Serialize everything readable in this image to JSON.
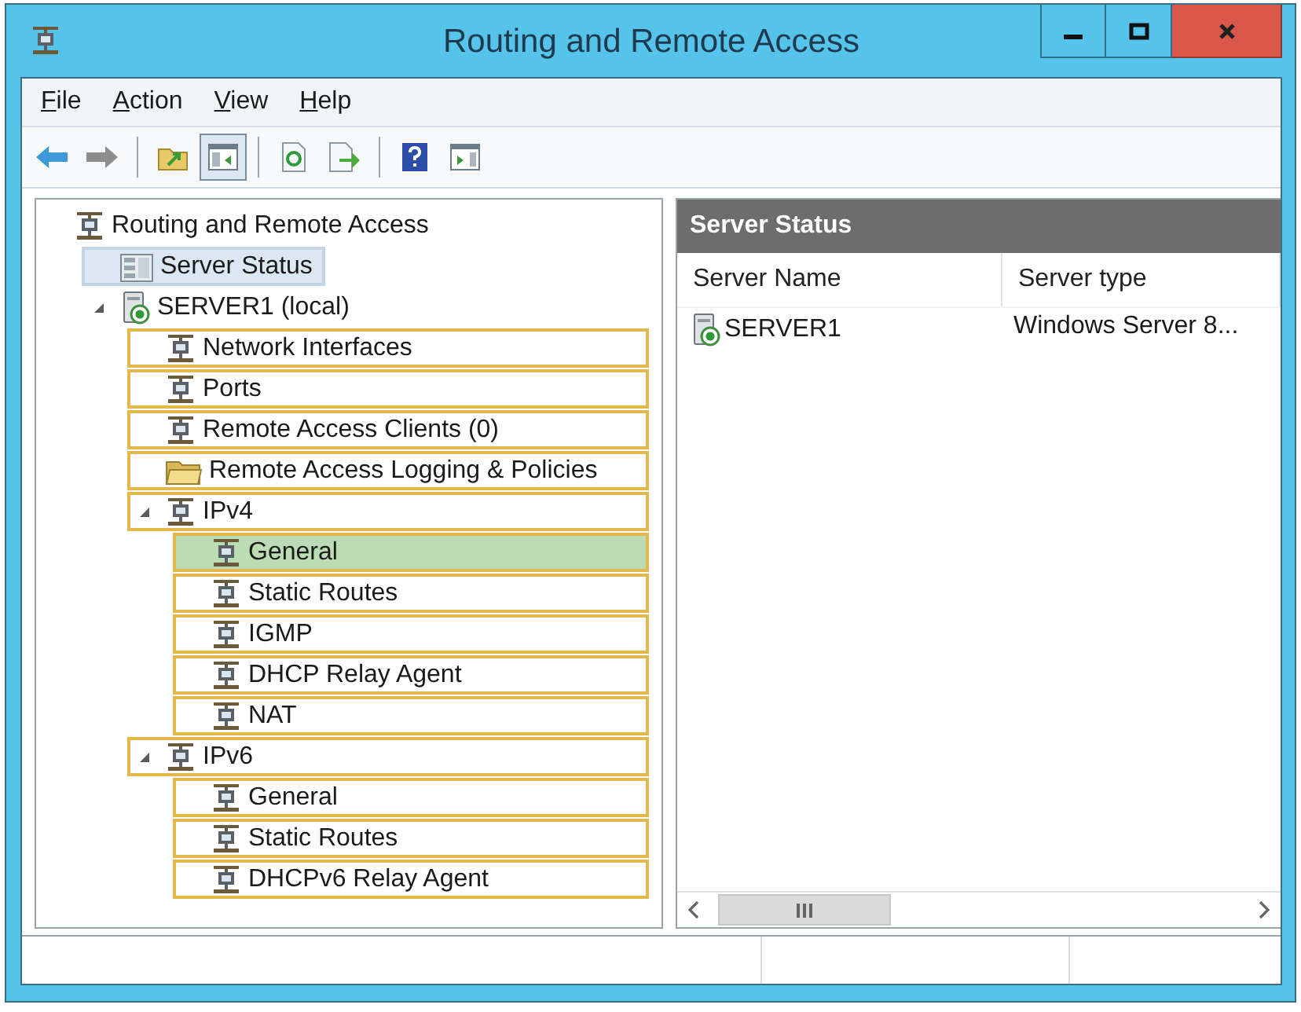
{
  "window": {
    "title": "Routing and Remote Access"
  },
  "menu": [
    {
      "label": "File",
      "access_key_underlined": true
    },
    {
      "label": "Action",
      "access_key_underlined": true
    },
    {
      "label": "View",
      "access_key_underlined": true
    },
    {
      "label": "Help",
      "access_key_underlined": true
    }
  ],
  "toolbar": [
    {
      "kind": "back",
      "pressed": false
    },
    {
      "kind": "forward",
      "pressed": false
    },
    {
      "kind": "separator"
    },
    {
      "kind": "up",
      "pressed": false
    },
    {
      "kind": "tree",
      "pressed": true
    },
    {
      "kind": "separator"
    },
    {
      "kind": "refresh",
      "pressed": false
    },
    {
      "kind": "export",
      "pressed": false
    },
    {
      "kind": "separator"
    },
    {
      "kind": "help",
      "pressed": false
    },
    {
      "kind": "pane",
      "pressed": false
    }
  ],
  "tree": {
    "label": "Routing and Remote Access",
    "kind": "network",
    "selected": false,
    "outlined": false,
    "marked": false,
    "children": [
      {
        "label": "Server Status",
        "kind": "serverlist",
        "selected": true,
        "outlined": false,
        "marked": false
      },
      {
        "label": "SERVER1 (local)",
        "kind": "server",
        "selected": false,
        "outlined": false,
        "marked": false,
        "expanded": true,
        "children": [
          {
            "label": "Network Interfaces",
            "kind": "network",
            "selected": false,
            "outlined": true,
            "marked": false
          },
          {
            "label": "Ports",
            "kind": "network",
            "selected": false,
            "outlined": true,
            "marked": false
          },
          {
            "label": "Remote Access Clients (0)",
            "kind": "network",
            "selected": false,
            "outlined": true,
            "marked": false
          },
          {
            "label": "Remote Access Logging & Policies",
            "kind": "folder",
            "selected": false,
            "outlined": true,
            "marked": false
          },
          {
            "label": "IPv4",
            "kind": "network",
            "selected": false,
            "outlined": true,
            "marked": false,
            "expanded": true,
            "children": [
              {
                "label": "General",
                "kind": "network",
                "selected": false,
                "outlined": true,
                "marked": true
              },
              {
                "label": "Static Routes",
                "kind": "network",
                "selected": false,
                "outlined": true,
                "marked": false
              },
              {
                "label": "IGMP",
                "kind": "network",
                "selected": false,
                "outlined": true,
                "marked": false
              },
              {
                "label": "DHCP Relay Agent",
                "kind": "network",
                "selected": false,
                "outlined": true,
                "marked": false
              },
              {
                "label": "NAT",
                "kind": "network",
                "selected": false,
                "outlined": true,
                "marked": false
              }
            ]
          },
          {
            "label": "IPv6",
            "kind": "network",
            "selected": false,
            "outlined": true,
            "marked": false,
            "expanded": true,
            "children": [
              {
                "label": "General",
                "kind": "network",
                "selected": false,
                "outlined": true,
                "marked": false
              },
              {
                "label": "Static Routes",
                "kind": "network",
                "selected": false,
                "outlined": true,
                "marked": false
              },
              {
                "label": "DHCPv6 Relay Agent",
                "kind": "network",
                "selected": false,
                "outlined": true,
                "marked": false
              }
            ]
          }
        ]
      }
    ]
  },
  "details": {
    "title": "Server Status",
    "columns": [
      "Server Name",
      "Server type"
    ],
    "rows": [
      {
        "cells": [
          "SERVER1",
          "Windows Server 8..."
        ]
      }
    ]
  }
}
